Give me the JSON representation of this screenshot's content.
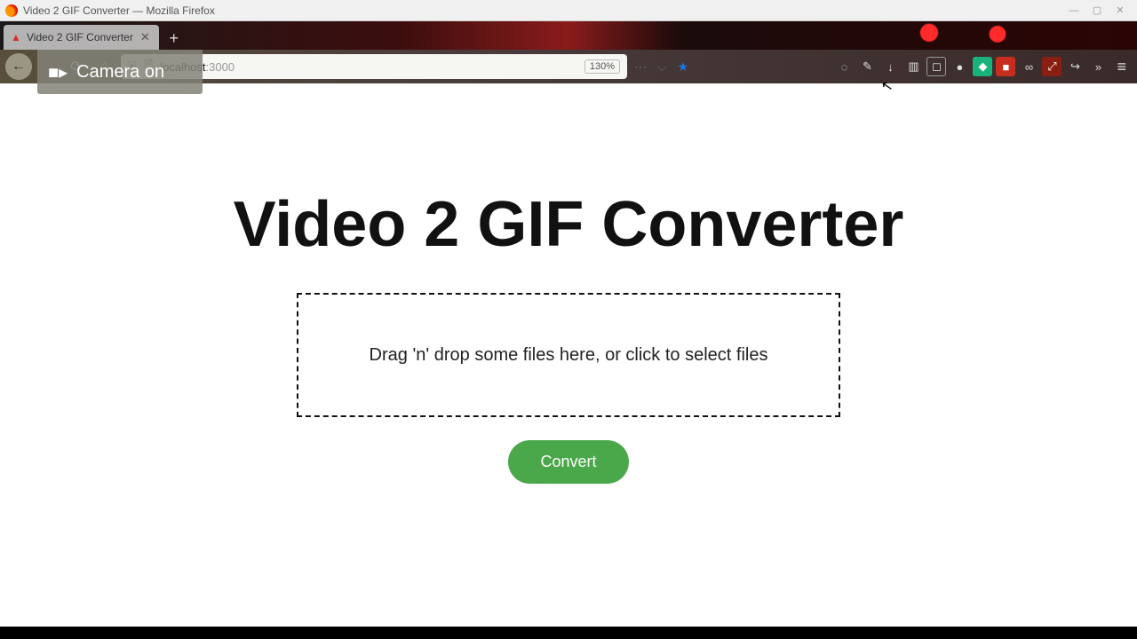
{
  "window": {
    "title": "Video 2 GIF Converter — Mozilla Firefox"
  },
  "tab": {
    "title": "Video 2 GIF Converter"
  },
  "nav": {
    "url_host": "localhost",
    "url_port": ":3000",
    "zoom_label": "130%"
  },
  "overlay": {
    "camera_label": "Camera on"
  },
  "page": {
    "heading": "Video 2 GIF Converter",
    "dropzone_text": "Drag 'n' drop some files here, or click to select files",
    "convert_label": "Convert"
  }
}
